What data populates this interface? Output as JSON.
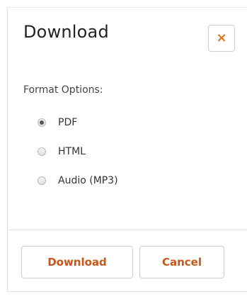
{
  "dialog": {
    "title": "Download",
    "close_icon_glyph": "×",
    "close_icon_color": "#e07418"
  },
  "format": {
    "label": "Format Options:",
    "options": [
      {
        "label": "PDF",
        "selected": true
      },
      {
        "label": "HTML",
        "selected": false
      },
      {
        "label": "Audio (MP3)",
        "selected": false
      }
    ]
  },
  "footer": {
    "download_label": "Download",
    "cancel_label": "Cancel",
    "button_text_color": "#c8561a"
  }
}
